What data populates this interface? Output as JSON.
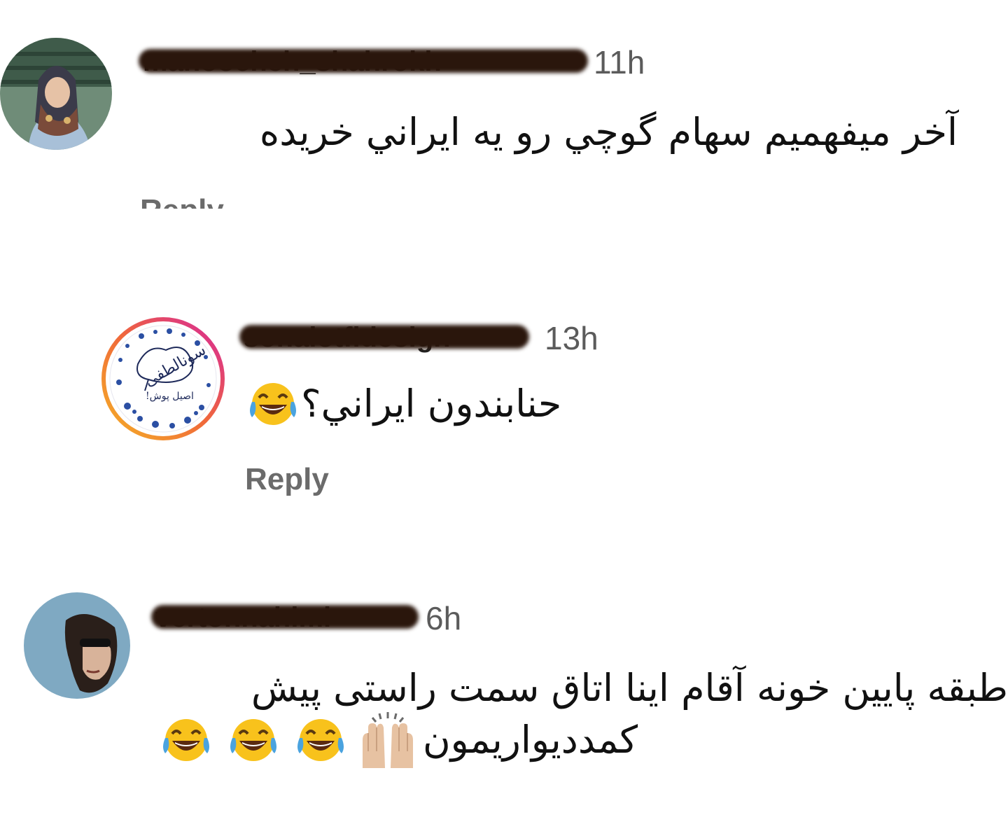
{
  "comments": [
    {
      "username": "manoocheh_shahrokh",
      "time": "11h",
      "text": "آخر ميفهميم سهام گوچي رو يه ايراني خريده",
      "reply_label": "Reply"
    },
    {
      "username": "sonalotfidesign",
      "time": "13h",
      "text": "حنابندون ايراني؟",
      "reply_label": "Reply",
      "avatar_logo_text": "سونالطفی",
      "avatar_logo_subtext": "اصیل پوش!"
    },
    {
      "username": "vertonnahimi",
      "time": "6h",
      "text_line1": "طبقه پايين خونه آقام اينا اتاق سمت راستی پيش",
      "text_line2": "كمدديواريمون"
    }
  ],
  "icons": {
    "laughing": "face-with-tears-of-joy-icon",
    "raised_hands": "raising-hands-icon"
  },
  "colors": {
    "text": "#111111",
    "muted": "#5b5b5b",
    "reply": "#6b6b6b",
    "story_ring_start": "#f58529",
    "story_ring_end": "#dd2a7b",
    "emoji_yellow": "#f8c21c",
    "tear_blue": "#4aa3df"
  }
}
